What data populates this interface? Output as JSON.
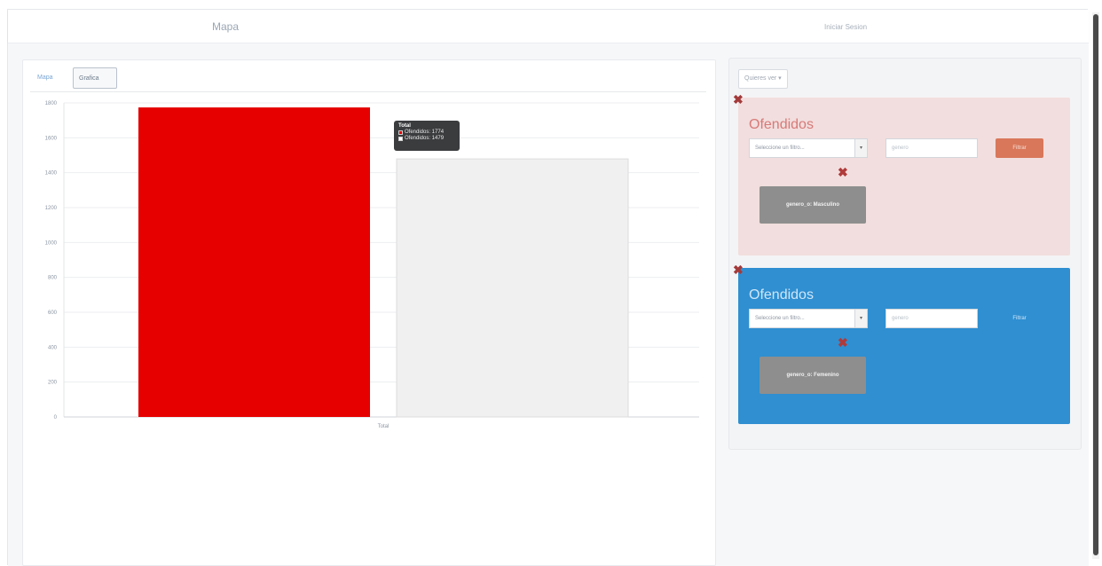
{
  "navbar": {
    "title": "Mapa",
    "right_link": "Iniciar Sesion"
  },
  "tabs": [
    {
      "label": "Mapa"
    },
    {
      "label": "Grafica"
    }
  ],
  "chart_data": {
    "type": "bar",
    "categories": [
      "Total"
    ],
    "series": [
      {
        "name": "Ofendidos",
        "values": [
          1774
        ],
        "color": "#e60000"
      },
      {
        "name": "Ofendidos",
        "values": [
          1479
        ],
        "color": "#f0f0f0"
      }
    ],
    "ylim": [
      0,
      1800
    ],
    "yticks": [
      0,
      200,
      400,
      600,
      800,
      1000,
      1200,
      1400,
      1600,
      1800
    ],
    "xlabel": "",
    "ylabel": "",
    "grid": true,
    "tooltip": {
      "title": "Total",
      "rows": [
        {
          "label": "Ofendidos: 1774",
          "color": "#e60000"
        },
        {
          "label": "Ofendidos: 1479",
          "color": "#ffffff"
        }
      ]
    }
  },
  "right_panel": {
    "query_button": "Quieres ver ▾",
    "cards": [
      {
        "title": "Ofendidos",
        "select_value": "Seleccione un filtro...",
        "input_placeholder": "genero",
        "filter_label": "Filtrar",
        "tag": "genero_o: Masculino",
        "color": "#f2dede"
      },
      {
        "title": "Ofendidos",
        "select_value": "Seleccione un filtro...",
        "input_placeholder": "genero",
        "filter_label": "Filtrar",
        "tag": "genero_o: Femenino",
        "color": "#2f8fd1"
      }
    ]
  },
  "icons": {
    "remove": "close-icon",
    "caret": "chevron-down-icon"
  }
}
